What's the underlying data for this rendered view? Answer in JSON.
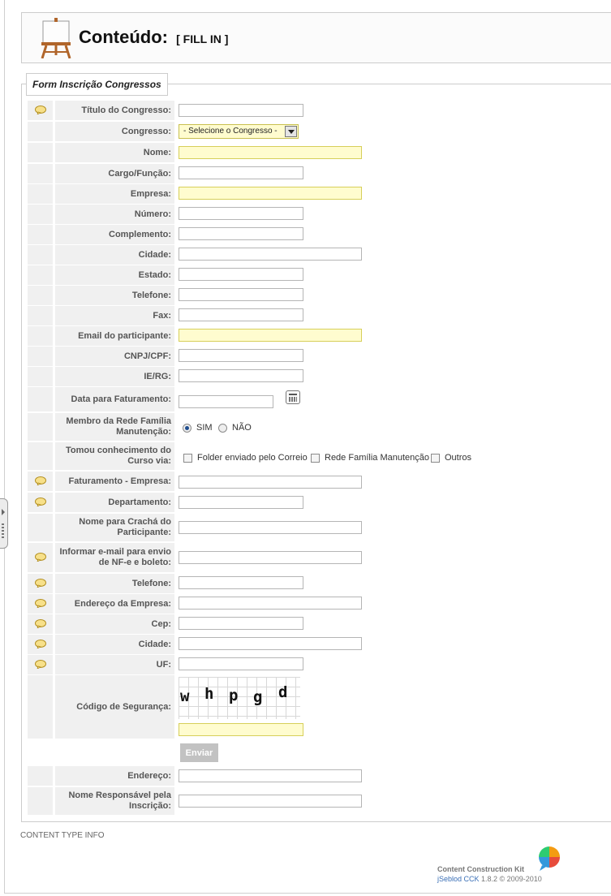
{
  "header": {
    "title": "Conteúdo:",
    "subtitle": "[ FILL IN ]"
  },
  "form": {
    "legend": "Form Inscrição Congressos",
    "labels": {
      "titulo": "Título do Congresso:",
      "congresso": "Congresso:",
      "nome": "Nome:",
      "cargo": "Cargo/Função:",
      "empresa": "Empresa:",
      "numero": "Número:",
      "complemento": "Complemento:",
      "cidade": "Cidade:",
      "estado": "Estado:",
      "telefone": "Telefone:",
      "fax": "Fax:",
      "email": "Email do participante:",
      "cnpj": "CNPJ/CPF:",
      "ierg": "IE/RG:",
      "data_faturamento": "Data para Faturamento:",
      "membro": "Membro da Rede Família Manutenção:",
      "tomou": "Tomou conhecimento do Curso via:",
      "faturamento_empresa": "Faturamento - Empresa:",
      "departamento": "Departamento:",
      "nome_cracha": "Nome para Crachá do Participante:",
      "informar_email": "Informar e-mail para envio de NF-e e boleto:",
      "telefone2": "Telefone:",
      "endereco_empresa": "Endereço da Empresa:",
      "cep": "Cep:",
      "cidade2": "Cidade:",
      "uf": "UF:",
      "codigo": "Código de Segurança:",
      "endereco": "Endereço:",
      "nome_responsavel": "Nome Responsável pela Inscrição:"
    },
    "congresso_select": "- Selecione o Congresso -",
    "membro_options": [
      "SIM",
      "NÃO"
    ],
    "tomou_options": [
      "Folder enviado pelo Correio",
      "Rede Família Manutenção",
      "Outros"
    ],
    "captcha_chars": [
      "w",
      "h",
      "p",
      "g",
      "d"
    ],
    "submit_label": "Enviar"
  },
  "content_type_info": "CONTENT TYPE INFO",
  "footer": {
    "line1": "Content Construction Kit",
    "link": "jSeblod CCK",
    "version": " 1.8.2 © 2009-2010"
  },
  "icons": {
    "header": "easel-icon",
    "note": "speech-bubble-icon",
    "calendar": "calendar-icon",
    "logo": "jseblod-logo-icon"
  },
  "colors": {
    "required_field": "#fffccf",
    "label_cell": "#f0f0f0",
    "button": "#c2c2c2",
    "link": "#3a6fb6"
  }
}
